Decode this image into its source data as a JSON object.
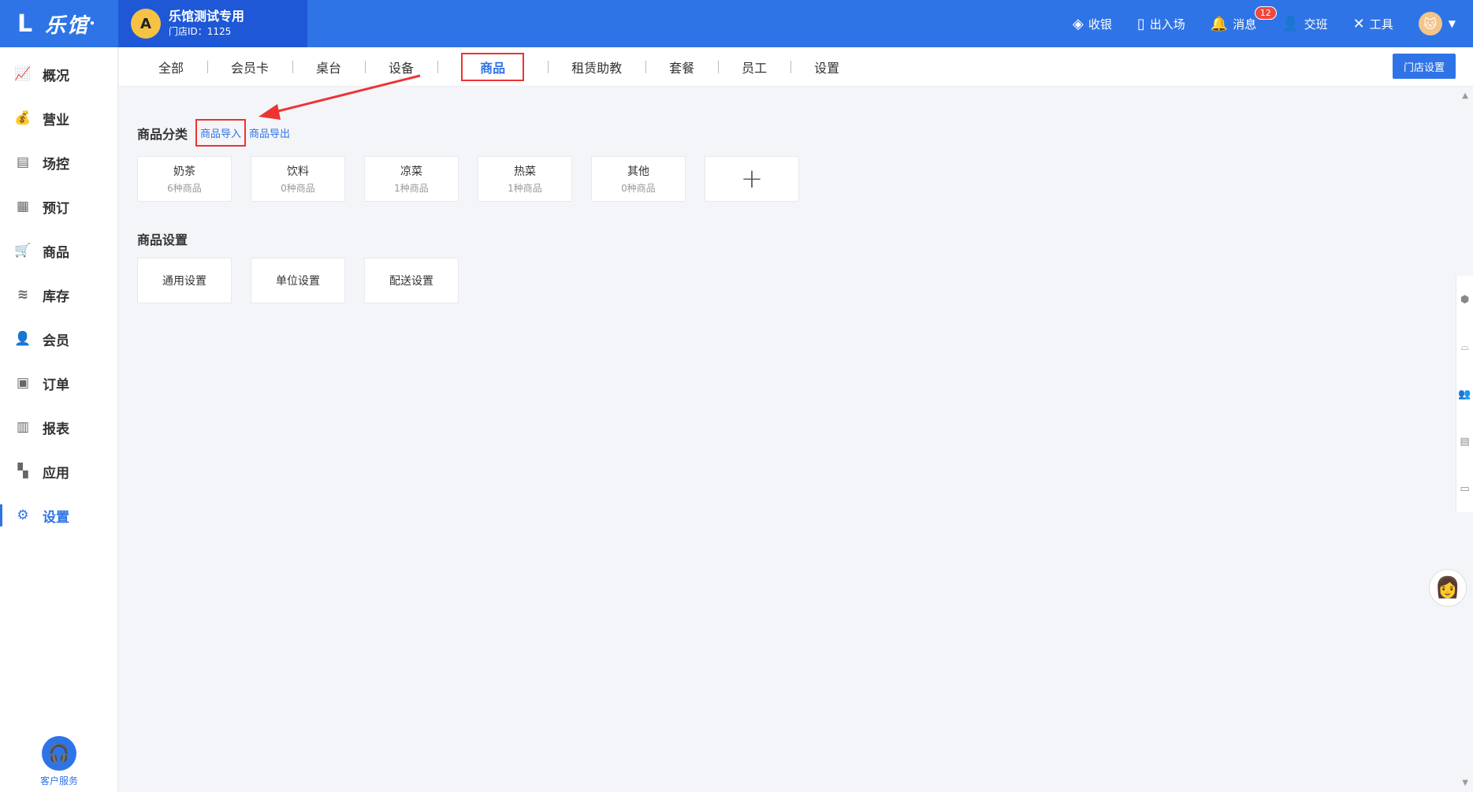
{
  "app": {
    "logo_text": "乐馆",
    "logo_mark": "L"
  },
  "store": {
    "avatar_letter": "A",
    "name": "乐馆测试专用",
    "id_label": "门店ID：1125"
  },
  "topnav": {
    "items": [
      {
        "icon": "cashier-icon",
        "glyph": "◈",
        "label": "收银"
      },
      {
        "icon": "door-icon",
        "glyph": "▯",
        "label": "出入场"
      },
      {
        "icon": "bell-icon",
        "glyph": "🔔",
        "label": "消息",
        "badge": "12"
      },
      {
        "icon": "shift-icon",
        "glyph": "👤",
        "label": "交班"
      },
      {
        "icon": "tools-icon",
        "glyph": "✕",
        "label": "工具"
      }
    ]
  },
  "sidebar": {
    "items": [
      {
        "glyph": "📈",
        "label": "概况"
      },
      {
        "glyph": "💰",
        "label": "营业"
      },
      {
        "glyph": "▤",
        "label": "场控"
      },
      {
        "glyph": "▦",
        "label": "预订"
      },
      {
        "glyph": "🛒",
        "label": "商品"
      },
      {
        "glyph": "≋",
        "label": "库存"
      },
      {
        "glyph": "👤",
        "label": "会员"
      },
      {
        "glyph": "▣",
        "label": "订单"
      },
      {
        "glyph": "▥",
        "label": "报表"
      },
      {
        "glyph": "▚",
        "label": "应用"
      },
      {
        "glyph": "⚙",
        "label": "设置"
      }
    ],
    "active_index": 10,
    "service_label": "客户服务"
  },
  "tabs": {
    "items": [
      "全部",
      "会员卡",
      "桌台",
      "设备",
      "商品",
      "租赁助教",
      "套餐",
      "员工",
      "设置"
    ],
    "active_index": 4,
    "store_settings_label": "门店设置"
  },
  "category_section": {
    "title": "商品分类",
    "import_link": "商品导入",
    "export_link": "商品导出",
    "categories": [
      {
        "name": "奶茶",
        "count": "6种商品"
      },
      {
        "name": "饮料",
        "count": "0种商品"
      },
      {
        "name": "凉菜",
        "count": "1种商品"
      },
      {
        "name": "热菜",
        "count": "1种商品"
      },
      {
        "name": "其他",
        "count": "0种商品"
      }
    ],
    "add_glyph": "+"
  },
  "settings_section": {
    "title": "商品设置",
    "items": [
      "通用设置",
      "单位设置",
      "配送设置"
    ]
  },
  "colors": {
    "primary": "#2f74e6",
    "highlight": "#ee3333",
    "background": "#f4f5f9"
  }
}
